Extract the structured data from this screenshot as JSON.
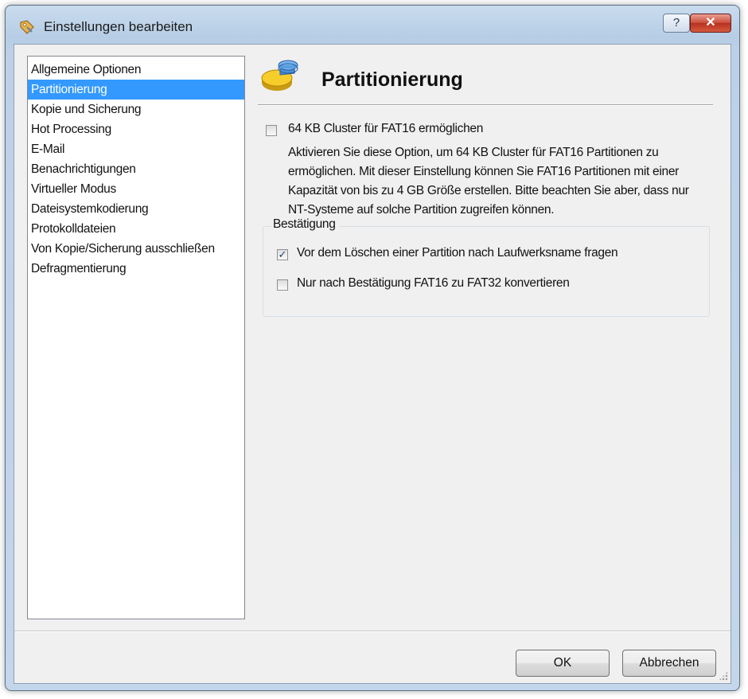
{
  "window": {
    "title": "Einstellungen bearbeiten",
    "help_label": "?",
    "close_label": "✕"
  },
  "nav": {
    "selected_index": 1,
    "items": [
      "Allgemeine Optionen",
      "Partitionierung",
      "Kopie und Sicherung",
      "Hot Processing",
      "E-Mail",
      "Benachrichtigungen",
      "Virtueller Modus",
      "Dateisystemkodierung",
      "Protokolldateien",
      "Von Kopie/Sicherung ausschließen",
      "Defragmentierung"
    ]
  },
  "pane": {
    "title": "Partitionierung",
    "icon": "partition-pie-icon",
    "fat16_option": {
      "label": "64 KB Cluster für FAT16 ermöglichen",
      "checked": false,
      "description": "Aktivieren Sie diese Option, um 64 KB Cluster für FAT16 Partitionen zu ermöglichen. Mit dieser Einstellung können Sie FAT16 Partitionen mit einer Kapazität von bis zu 4 GB Größe erstellen. Bitte beachten Sie aber, dass nur NT-Systeme auf solche Partition zugreifen können."
    },
    "group": {
      "label": "Bestätigung",
      "options": [
        {
          "label": "Vor dem Löschen einer Partition nach Laufwerksname fragen",
          "checked": true
        },
        {
          "label": "Nur nach Bestätigung FAT16 zu FAT32 konvertieren",
          "checked": false
        }
      ]
    }
  },
  "buttons": {
    "ok_label": "OK",
    "cancel_label": "Abbrechen"
  },
  "colors": {
    "selection": "#3399ff",
    "window_frame": "#bcd1e7",
    "close_button": "#c84a39"
  }
}
